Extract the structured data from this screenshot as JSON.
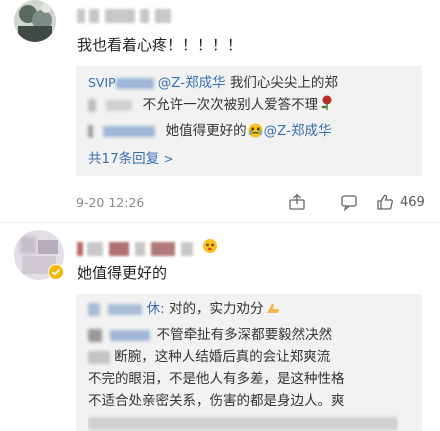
{
  "comment1": {
    "text": "我也看着心疼！！！！！",
    "reply1": {
      "prefix_visible": "SVIP",
      "mention": "@Z-郑成华",
      "line1_text": " 我们心尖尖上的郑",
      "line2_text": "不允许一次次被别人爱答不理"
    },
    "reply2": {
      "text": "她值得更好的",
      "mention": "@Z-郑成华"
    },
    "more_replies": "共17条回复",
    "more_arrow": ">",
    "time": "9-20 12:26",
    "likes": "469"
  },
  "comment2": {
    "text": "她值得更好的",
    "reply1": {
      "suffix_visible": "休:",
      "text": " 对的，实力劝分"
    },
    "reply2": {
      "line1": "不管牵扯有多深都要毅然决然",
      "line2_visible": "断腕，这种人结婚后真的会让郑爽流",
      "line3": "不完的眼泪，不是他人有多差，是这种性格",
      "line4": "不适合处亲密关系，伤害的都是身边人。爽"
    }
  },
  "icons": {
    "share": "share-icon",
    "comment": "comment-icon",
    "like": "thumbs-up-icon",
    "vip": "vip-badge-icon"
  },
  "colors": {
    "link": "#3a6fb0",
    "reply_bg": "#f2f2f2",
    "vip_gold": "#f5b800"
  }
}
